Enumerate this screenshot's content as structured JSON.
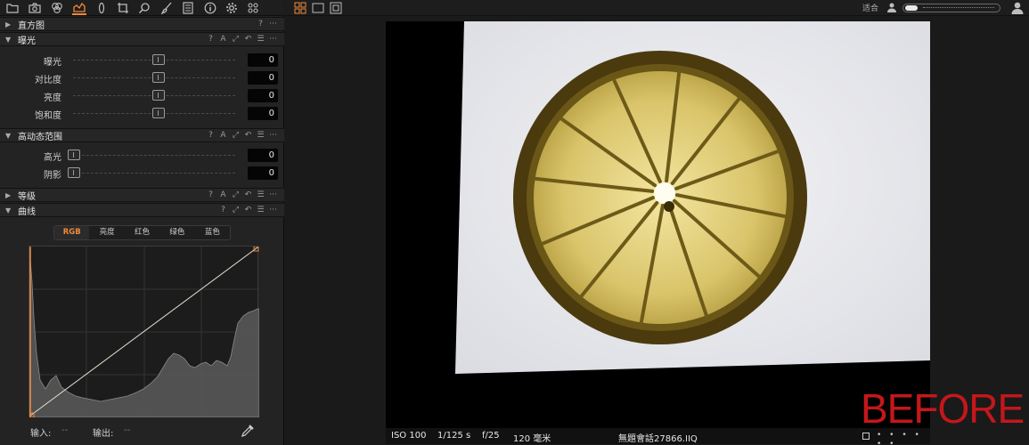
{
  "toolbar": {
    "icons": [
      "folder-icon",
      "camera-icon",
      "color-circles-icon",
      "exposure-icon",
      "lens-icon",
      "crop-icon",
      "search-icon",
      "brush-icon",
      "metadata-icon",
      "info-icon",
      "settings-icon",
      "styles-icon"
    ],
    "active_icon": "exposure-icon",
    "active_color": "#f08a3c"
  },
  "sections": {
    "histogram": {
      "title": "直方图",
      "collapsed": true,
      "help": "?",
      "more": "···"
    },
    "exposure": {
      "title": "曝光",
      "collapsed": false,
      "tools": [
        "?",
        "A",
        "⤢",
        "↶",
        "☰",
        "···"
      ],
      "sliders": [
        {
          "label": "曝光",
          "value": "0",
          "position": 0.5
        },
        {
          "label": "对比度",
          "value": "0",
          "position": 0.5
        },
        {
          "label": "亮度",
          "value": "0",
          "position": 0.5
        },
        {
          "label": "饱和度",
          "value": "0",
          "position": 0.5
        }
      ]
    },
    "hdr": {
      "title": "高动态范围",
      "collapsed": false,
      "tools": [
        "?",
        "A",
        "⤢",
        "↶",
        "☰",
        "···"
      ],
      "sliders": [
        {
          "label": "高光",
          "value": "0",
          "position": 0.0
        },
        {
          "label": "阴影",
          "value": "0",
          "position": 0.0
        }
      ]
    },
    "levels": {
      "title": "等级",
      "collapsed": true,
      "tools": [
        "?",
        "A",
        "⤢",
        "↶",
        "☰",
        "···"
      ]
    },
    "curve": {
      "title": "曲线",
      "collapsed": false,
      "tools": [
        "?",
        "⤢",
        "↶",
        "☰",
        "···"
      ],
      "tabs": [
        "RGB",
        "亮度",
        "红色",
        "绿色",
        "蓝色"
      ],
      "active_tab": "RGB",
      "input_label": "输入:",
      "input_value": "--",
      "output_label": "输出:",
      "output_value": "--"
    }
  },
  "viewer": {
    "fit_label": "适合",
    "before_label": "BEFORE",
    "before_color": "#c4171b",
    "meta": {
      "iso": "ISO 100",
      "shutter": "1/125 s",
      "aperture": "f/25",
      "focal": "120 毫米",
      "filename": "無題會話27866.IIQ",
      "rating_dots": "• • • • • •"
    }
  }
}
